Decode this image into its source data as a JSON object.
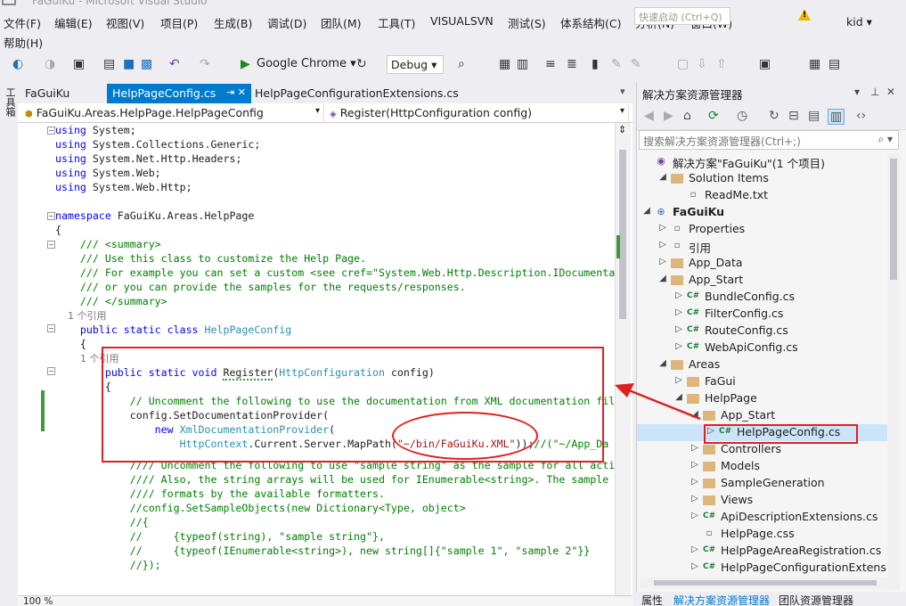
{
  "window": {
    "title": "FaGuiKu - Microsoft Visual Studio",
    "quick_launch": "快速启动 (Ctrl+Q)",
    "user": "kid"
  },
  "menu": [
    "文件(F)",
    "编辑(E)",
    "视图(V)",
    "项目(P)",
    "生成(B)",
    "调试(D)",
    "团队(M)",
    "工具(T)",
    "VISUALSVN",
    "测试(S)",
    "体系结构(C)",
    "分析(N)",
    "窗口(W)",
    "帮助(H)"
  ],
  "toolbar": {
    "run_target": "Google Chrome",
    "config": "Debug"
  },
  "left_strip": "工具箱",
  "tabs": [
    {
      "label": "FaGuiKu"
    },
    {
      "label": "HelpPageConfig.cs",
      "close": "⇥ ✕"
    },
    {
      "label": "HelpPageConfigurationExtensions.cs"
    }
  ],
  "nav": {
    "class": "FaGuiKu.Areas.HelpPage.HelpPageConfig",
    "member": "Register(HttpConfiguration config)"
  },
  "code": [
    [
      {
        "t": "kw",
        "v": "using"
      },
      {
        "t": "",
        "v": " System;"
      }
    ],
    [
      {
        "t": "kw",
        "v": "using"
      },
      {
        "t": "",
        "v": " System.Collections.Generic;"
      }
    ],
    [
      {
        "t": "kw",
        "v": "using"
      },
      {
        "t": "",
        "v": " System.Net.Http.Headers;"
      }
    ],
    [
      {
        "t": "kw",
        "v": "using"
      },
      {
        "t": "",
        "v": " System.Web;"
      }
    ],
    [
      {
        "t": "kw",
        "v": "using"
      },
      {
        "t": "",
        "v": " System.Web.Http;"
      }
    ],
    [],
    [
      {
        "t": "kw",
        "v": "namespace"
      },
      {
        "t": "",
        "v": " FaGuiKu.Areas.HelpPage"
      }
    ],
    [
      {
        "t": "",
        "v": "{"
      }
    ],
    [
      {
        "t": "cm",
        "v": "    /// <summary>"
      }
    ],
    [
      {
        "t": "cm",
        "v": "    /// Use this class to customize the Help Page."
      }
    ],
    [
      {
        "t": "cm",
        "v": "    /// For example you can set a custom <see cref=\"System.Web.Http.Description.IDocumenta"
      }
    ],
    [
      {
        "t": "cm",
        "v": "    /// or you can provide the samples for the requests/responses."
      }
    ],
    [
      {
        "t": "cm",
        "v": "    /// </summary>"
      }
    ],
    [
      {
        "t": "ref",
        "v": "    1 个引用"
      }
    ],
    [
      {
        "t": "kw",
        "v": "    public static class "
      },
      {
        "t": "ty",
        "v": "HelpPageConfig"
      }
    ],
    [
      {
        "t": "",
        "v": "    {"
      }
    ],
    [
      {
        "t": "ref",
        "v": "        1 个引用"
      }
    ],
    [
      {
        "t": "kw",
        "v": "        public static void "
      },
      {
        "t": "sq",
        "v": "Register"
      },
      {
        "t": "",
        "v": "("
      },
      {
        "t": "ty",
        "v": "HttpConfiguration"
      },
      {
        "t": "",
        "v": " config)"
      }
    ],
    [
      {
        "t": "",
        "v": "        {"
      }
    ],
    [
      {
        "t": "cm",
        "v": "            // Uncomment the following to use the documentation from XML documentation fil"
      }
    ],
    [
      {
        "t": "",
        "v": "            config.SetDocumentationProvider("
      }
    ],
    [
      {
        "t": "kw",
        "v": "                new "
      },
      {
        "t": "ty",
        "v": "XmlDocumentationProvider"
      },
      {
        "t": "",
        "v": "("
      }
    ],
    [
      {
        "t": "ty",
        "v": "                    HttpContext"
      },
      {
        "t": "",
        "v": ".Current.Server.MapPath("
      },
      {
        "t": "st",
        "v": "\"~/bin/FaGuiKu.XML\""
      },
      {
        "t": "",
        "v": "));"
      },
      {
        "t": "cm",
        "v": "//(\"~/App_Da"
      }
    ],
    [
      {
        "t": "cm",
        "v": "            //// Uncomment the following to use \"sample string\" as the sample for all acti"
      }
    ],
    [
      {
        "t": "cm",
        "v": "            //// Also, the string arrays will be used for IEnumerable<string>. The sample"
      }
    ],
    [
      {
        "t": "cm",
        "v": "            //// formats by the available formatters."
      }
    ],
    [
      {
        "t": "cm",
        "v": "            //config.SetSampleObjects(new Dictionary<Type, object>"
      }
    ],
    [
      {
        "t": "cm",
        "v": "            //{"
      }
    ],
    [
      {
        "t": "cm",
        "v": "            //     {typeof(string), \"sample string\"},"
      }
    ],
    [
      {
        "t": "cm",
        "v": "            //     {typeof(IEnumerable<string>), new string[]{\"sample 1\", \"sample 2\"}}"
      }
    ],
    [
      {
        "t": "cm",
        "v": "            //});"
      }
    ]
  ],
  "zoom": "100 %",
  "explorer": {
    "title": "解决方案资源管理器",
    "search_placeholder": "搜索解决方案资源管理器(Ctrl+;)",
    "nodes": [
      {
        "label": "解决方案\"FaGuiKu\"(1 个项目)",
        "icon": "sol",
        "arrow": ""
      },
      {
        "label": "Solution Items",
        "icon": "folder",
        "arrow": "◢"
      },
      {
        "label": "ReadMe.txt",
        "icon": "file",
        "arrow": ""
      },
      {
        "label": "FaGuiKu",
        "icon": "proj",
        "arrow": "◢",
        "bold": true
      },
      {
        "label": "Properties",
        "icon": "file",
        "arrow": "▷"
      },
      {
        "label": "引用",
        "icon": "file",
        "arrow": "▷"
      },
      {
        "label": "App_Data",
        "icon": "folder",
        "arrow": "▷"
      },
      {
        "label": "App_Start",
        "icon": "folder",
        "arrow": "◢"
      },
      {
        "label": "BundleConfig.cs",
        "icon": "cs",
        "arrow": "▷"
      },
      {
        "label": "FilterConfig.cs",
        "icon": "cs",
        "arrow": "▷"
      },
      {
        "label": "RouteConfig.cs",
        "icon": "cs",
        "arrow": "▷"
      },
      {
        "label": "WebApiConfig.cs",
        "icon": "cs",
        "arrow": "▷"
      },
      {
        "label": "Areas",
        "icon": "folder",
        "arrow": "◢"
      },
      {
        "label": "FaGui",
        "icon": "folder",
        "arrow": "▷"
      },
      {
        "label": "HelpPage",
        "icon": "folder",
        "arrow": "◢"
      },
      {
        "label": "App_Start",
        "icon": "folder",
        "arrow": "◢"
      },
      {
        "label": "HelpPageConfig.cs",
        "icon": "cs",
        "arrow": "▷",
        "selected": true
      },
      {
        "label": "Controllers",
        "icon": "folder",
        "arrow": "▷"
      },
      {
        "label": "Models",
        "icon": "folder",
        "arrow": "▷"
      },
      {
        "label": "SampleGeneration",
        "icon": "folder",
        "arrow": "▷"
      },
      {
        "label": "Views",
        "icon": "folder",
        "arrow": "▷"
      },
      {
        "label": "ApiDescriptionExtensions.cs",
        "icon": "cs",
        "arrow": "▷"
      },
      {
        "label": "HelpPage.css",
        "icon": "file",
        "arrow": ""
      },
      {
        "label": "HelpPageAreaRegistration.cs",
        "icon": "cs",
        "arrow": "▷"
      },
      {
        "label": "HelpPageConfigurationExtens",
        "icon": "cs",
        "arrow": "▷"
      }
    ]
  },
  "bottom_tabs": [
    "属性",
    "解决方案资源管理器",
    "团队资源管理器"
  ]
}
